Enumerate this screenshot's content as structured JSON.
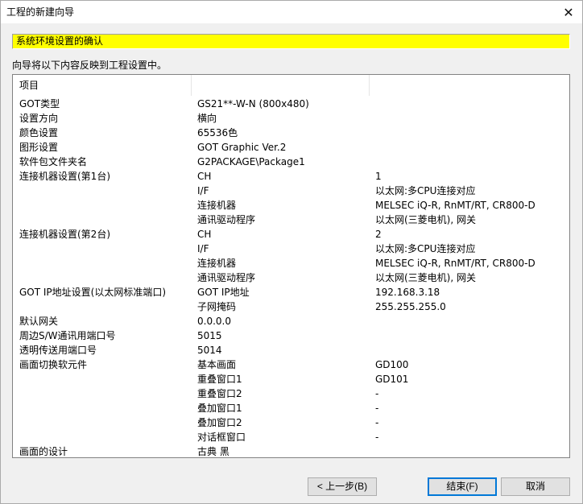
{
  "window": {
    "title": "工程的新建向导",
    "close_label": "✕"
  },
  "banner": "系统环境设置的确认",
  "subtitle": "向导将以下内容反映到工程设置中。",
  "table": {
    "header": [
      "项目",
      "",
      ""
    ],
    "rows": [
      [
        "GOT类型",
        "GS21**-W-N (800x480)",
        ""
      ],
      [
        "设置方向",
        "横向",
        ""
      ],
      [
        "颜色设置",
        "65536色",
        ""
      ],
      [
        "图形设置",
        "GOT Graphic Ver.2",
        ""
      ],
      [
        "软件包文件夹名",
        "G2PACKAGE\\Package1",
        ""
      ],
      [
        "连接机器设置(第1台)",
        "CH",
        "1"
      ],
      [
        "",
        "I/F",
        "以太网:多CPU连接对应"
      ],
      [
        "",
        "连接机器",
        "MELSEC iQ-R, RnMT/RT, CR800-D"
      ],
      [
        "",
        "通讯驱动程序",
        "以太网(三菱电机), 网关"
      ],
      [
        "连接机器设置(第2台)",
        "CH",
        "2"
      ],
      [
        "",
        "I/F",
        "以太网:多CPU连接对应"
      ],
      [
        "",
        "连接机器",
        "MELSEC iQ-R, RnMT/RT, CR800-D"
      ],
      [
        "",
        "通讯驱动程序",
        "以太网(三菱电机), 网关"
      ],
      [
        "GOT IP地址设置(以太网标准端口)",
        "GOT IP地址",
        "192.168.3.18"
      ],
      [
        "",
        "子网掩码",
        "255.255.255.0"
      ],
      [
        "默认网关",
        "0.0.0.0",
        ""
      ],
      [
        "周边S/W通讯用端口号",
        "5015",
        ""
      ],
      [
        "透明传送用端口号",
        "5014",
        ""
      ],
      [
        "画面切换软元件",
        "基本画面",
        "GD100"
      ],
      [
        "",
        "重叠窗口1",
        "GD101"
      ],
      [
        "",
        "重叠窗口2",
        "-"
      ],
      [
        "",
        "叠加窗口1",
        "-"
      ],
      [
        "",
        "叠加窗口2",
        "-"
      ],
      [
        "",
        "对话框窗口",
        "-"
      ],
      [
        "画面的设计",
        "古典 黑",
        ""
      ]
    ]
  },
  "buttons": {
    "back": "< 上一步(B)",
    "finish": "结束(F)",
    "cancel": "取消"
  },
  "colors": {
    "banner_bg": "#ffff00",
    "default_button_border": "#0078d7"
  }
}
